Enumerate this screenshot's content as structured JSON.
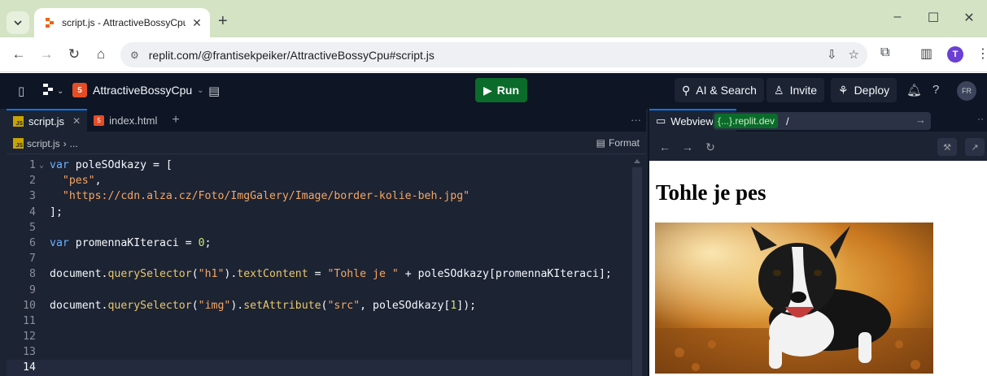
{
  "browser": {
    "tab_title": "script.js - AttractiveBossyCpu - I",
    "url_host": "replit.com",
    "url_path": "/@frantisekpeiker/AttractiveBossyCpu#script.js",
    "profile_initial": "T"
  },
  "replit": {
    "repl_name": "AttractiveBossyCpu",
    "run_label": "Run",
    "ai_search_label": "AI & Search",
    "invite_label": "Invite",
    "deploy_label": "Deploy",
    "user_initials": "FR",
    "accent_color": "#0079f2",
    "run_color": "#0b6b2a"
  },
  "editor": {
    "tabs": [
      {
        "label": "script.js",
        "active": true,
        "icon": "js-file-icon"
      },
      {
        "label": "index.html",
        "active": false,
        "icon": "html-file-icon"
      }
    ],
    "breadcrumb": {
      "file": "script.js",
      "rest": "..."
    },
    "format_label": "Format",
    "line_numbers": [
      "1",
      "2",
      "3",
      "4",
      "5",
      "6",
      "7",
      "8",
      "9",
      "10",
      "11",
      "12",
      "13",
      "14"
    ],
    "code": {
      "l1_kw": "var",
      "l1_rest": " poleSOdkazy = [",
      "l2_str": "\"pes\"",
      "l2_rest": ",",
      "l3_str": "\"https://cdn.alza.cz/Foto/ImgGalery/Image/border-kolie-beh.jpg\"",
      "l4": "];",
      "l6_kw": "var",
      "l6_rest": " promennaKIteraci = ",
      "l6_num": "0",
      "l6_end": ";",
      "l8_a": "document.",
      "l8_fn": "querySelector",
      "l8_b": "(",
      "l8_str1": "\"h1\"",
      "l8_c": ").",
      "l8_fn2": "textContent",
      "l8_d": " = ",
      "l8_str2": "\"Tohle je \"",
      "l8_e": " + poleSOdkazy[promennaKIteraci];",
      "l10_a": "document.",
      "l10_fn": "querySelector",
      "l10_b": "(",
      "l10_str1": "\"img\"",
      "l10_c": ").",
      "l10_fn2": "setAttribute",
      "l10_d": "(",
      "l10_str2": "\"src\"",
      "l10_e": ", poleSOdkazy[",
      "l10_num": "1",
      "l10_f": "]);"
    }
  },
  "webview": {
    "tab_label": "Webview",
    "dev_badge": "{...}.replit.dev",
    "path": "/",
    "page_heading": "Tohle je pes",
    "image_subject": "border-collie-running-photo"
  }
}
